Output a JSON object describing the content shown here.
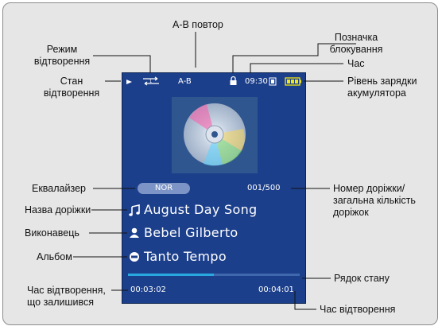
{
  "callouts": {
    "ab_repeat": "A-B повтор",
    "play_mode_1": "Режим",
    "play_mode_2": "відтворення",
    "lock_icon_1": "Позначка",
    "lock_icon_2": "блокування",
    "time": "Час",
    "play_state_1": "Стан",
    "play_state_2": "відтворення",
    "battery_1": "Рівень зарядки",
    "battery_2": "акумулятора",
    "equalizer": "Еквалайзер",
    "track_number_1": "Номер доріжки/",
    "track_number_2": "загальна кількість",
    "track_number_3": "доріжок",
    "track_name": "Назва доріжки",
    "artist": "Виконавець",
    "album": "Альбом",
    "status_bar": "Рядок стану",
    "remaining_1": "Час відтворення,",
    "remaining_2": "що залишився",
    "elapsed": "Час відтворення"
  },
  "screen": {
    "ab_text": "A-B",
    "clock": "09:30",
    "eq_badge": "NOR",
    "track_counter": "001/500",
    "track_title": "August Day Song",
    "artist_name": "Bebel Gilberto",
    "album_name": "Tanto Tempo",
    "remaining_time": "00:03:02",
    "elapsed_time": "00:04:01",
    "progress": 0.5
  },
  "colors": {
    "screen_bg": "#1c3f8b",
    "eq_badge_bg": "#7d94c6",
    "progress_fill": "#29a9e0"
  }
}
